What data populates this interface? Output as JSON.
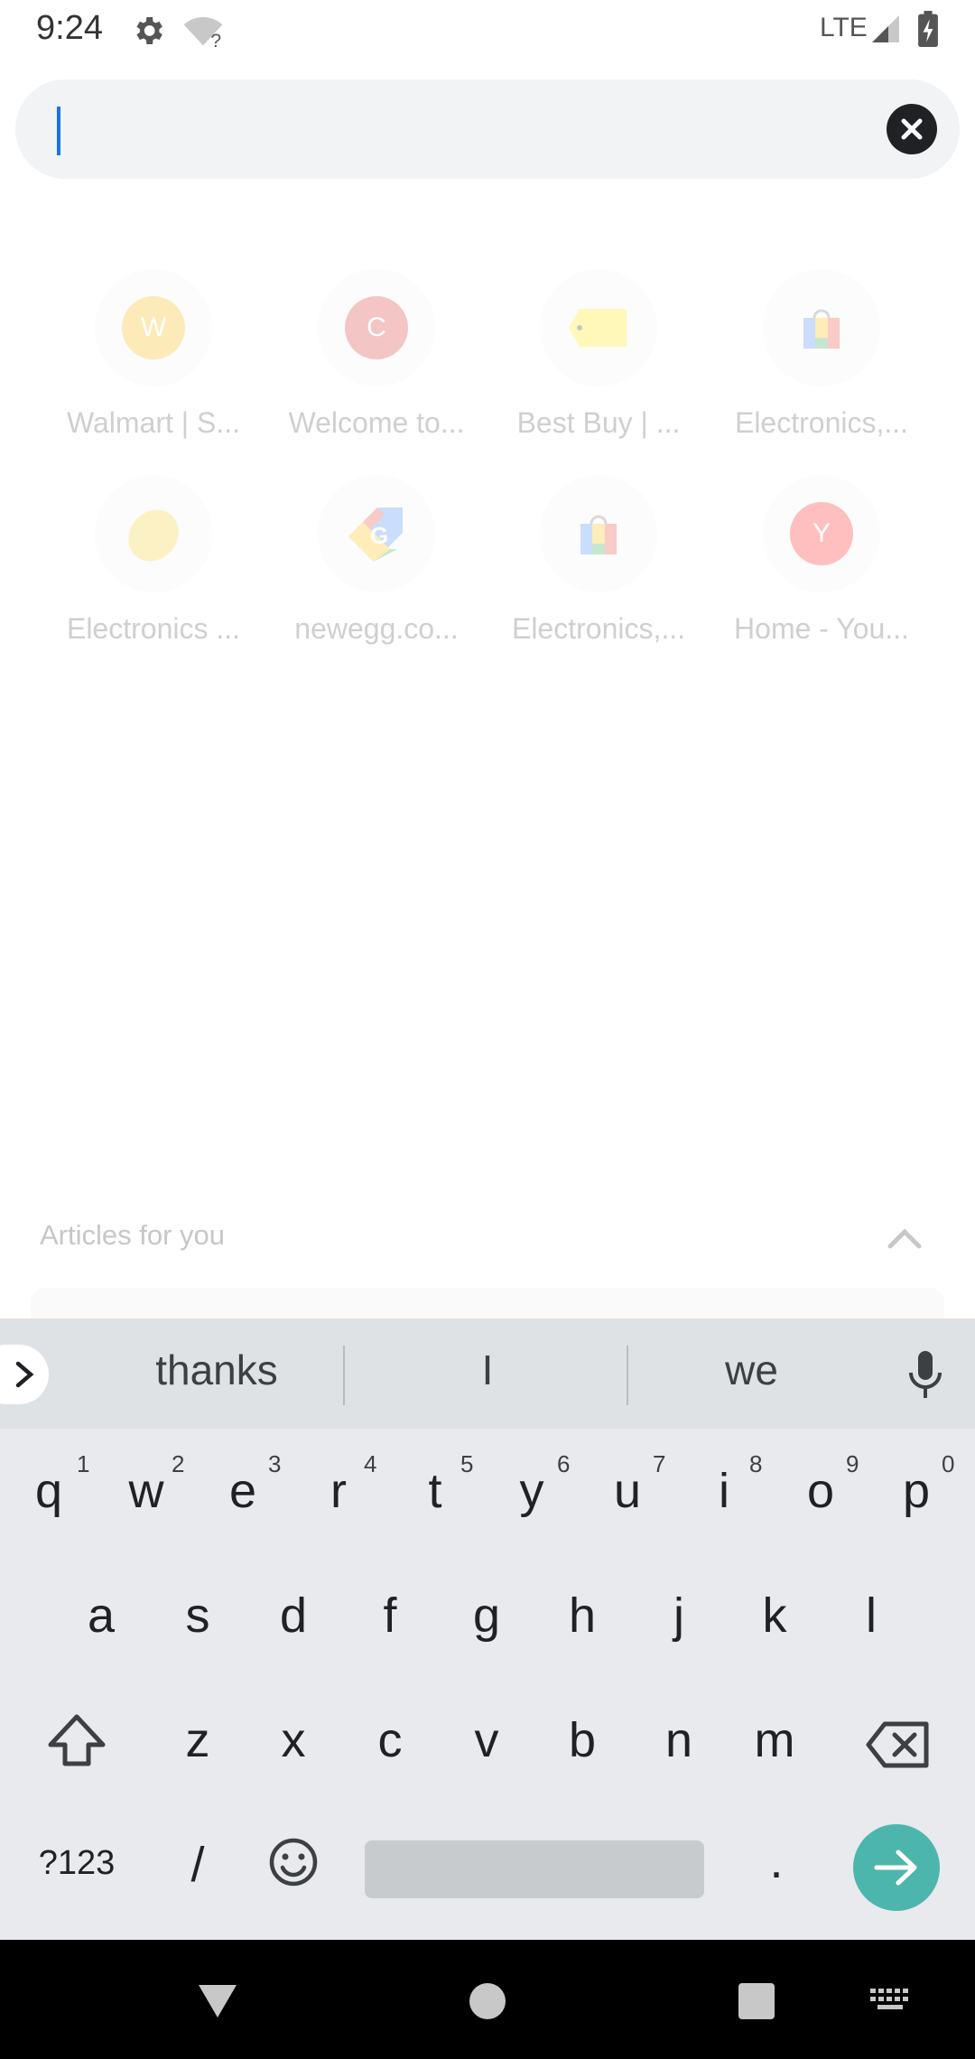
{
  "status_bar": {
    "time": "9:24",
    "network": "LTE",
    "icons": [
      "gear-icon",
      "wifi-question-icon",
      "signal-icon",
      "battery-charging-icon"
    ]
  },
  "search": {
    "value": "",
    "placeholder": "",
    "clear_icon": "close-icon"
  },
  "tiles": [
    {
      "label": "Walmart | S...",
      "letter": "W",
      "color": "#f5b400",
      "icon": "letter"
    },
    {
      "label": "Welcome to...",
      "letter": "C",
      "color": "#d32f2f",
      "icon": "letter"
    },
    {
      "label": "Best Buy | ...",
      "letter": "",
      "color": "#ffeb3b",
      "icon": "tag-icon"
    },
    {
      "label": "Electronics,...",
      "letter": "",
      "color": "#9e9e9e",
      "icon": "shopping-bag-icon"
    },
    {
      "label": "Electronics ...",
      "letter": "",
      "color": "#f6e08a",
      "icon": "egg-icon"
    },
    {
      "label": "newegg.co...",
      "letter": "",
      "color": "#4285f4",
      "icon": "google-shopping-icon"
    },
    {
      "label": "Electronics,...",
      "letter": "",
      "color": "#9e9e9e",
      "icon": "shopping-bag-icon"
    },
    {
      "label": "Home - You...",
      "letter": "Y",
      "color": "#ff1a1a",
      "icon": "letter"
    }
  ],
  "articles": {
    "title": "Articles for you",
    "toggle_icon": "chevron-up-icon"
  },
  "keyboard": {
    "suggestions": [
      "thanks",
      "I",
      "we"
    ],
    "row1": [
      {
        "key": "q",
        "hint": "1"
      },
      {
        "key": "w",
        "hint": "2"
      },
      {
        "key": "e",
        "hint": "3"
      },
      {
        "key": "r",
        "hint": "4"
      },
      {
        "key": "t",
        "hint": "5"
      },
      {
        "key": "y",
        "hint": "6"
      },
      {
        "key": "u",
        "hint": "7"
      },
      {
        "key": "i",
        "hint": "8"
      },
      {
        "key": "o",
        "hint": "9"
      },
      {
        "key": "p",
        "hint": "0"
      }
    ],
    "row2": [
      "a",
      "s",
      "d",
      "f",
      "g",
      "h",
      "j",
      "k",
      "l"
    ],
    "row3": [
      "z",
      "x",
      "c",
      "v",
      "b",
      "n",
      "m"
    ],
    "symbols_label": "?123",
    "slash": "/",
    "period": "."
  },
  "nav_bar": {
    "icons": [
      "back-icon",
      "home-icon",
      "recents-icon",
      "keyboard-icon"
    ]
  }
}
